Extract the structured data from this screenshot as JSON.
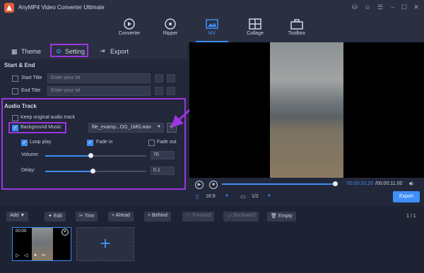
{
  "app": {
    "title": "AnyMP4 Video Converter Ultimate"
  },
  "nav": {
    "tabs": [
      {
        "label": "Converter"
      },
      {
        "label": "Ripper"
      },
      {
        "label": "MV"
      },
      {
        "label": "Collage"
      },
      {
        "label": "Toolbox"
      }
    ]
  },
  "subtabs": {
    "theme": "Theme",
    "setting": "Setting",
    "export": "Export"
  },
  "start_end": {
    "heading": "Start & End",
    "start_label": "Start Title",
    "start_placeholder": "Enter your txt",
    "end_label": "End Title",
    "end_placeholder": "Enter your txt"
  },
  "audio": {
    "heading": "Audio Track",
    "keep_original": "Keep original audio track",
    "bg_music": "Background Music",
    "file": "file_examp...OG_1MG.wav",
    "loop": "Loop play",
    "fade_in": "Fade in",
    "fade_out": "Fade out",
    "volume_label": "Volume:",
    "volume_value": "70",
    "volume_level": 0.45,
    "delay_label": "Delay:",
    "delay_value": "0.1",
    "delay_level": 0.47
  },
  "player": {
    "current": "00:00:10.20",
    "total": "/00:00:11.00",
    "progress": 0.93,
    "aspect": "16:9",
    "page": "1/2",
    "export": "Export"
  },
  "toolbar": {
    "add": "Add",
    "edit": "Edit",
    "trim": "Trim",
    "ahead": "Ahead",
    "behind": "Behind",
    "forward": "Forward",
    "backward": "Backward",
    "empty": "Empty",
    "page": "1 / 1"
  },
  "clip": {
    "duration": "00:00:"
  },
  "colors": {
    "accent": "#3e8ff6",
    "highlight": "#9c36e0",
    "panel": "#22273a"
  }
}
